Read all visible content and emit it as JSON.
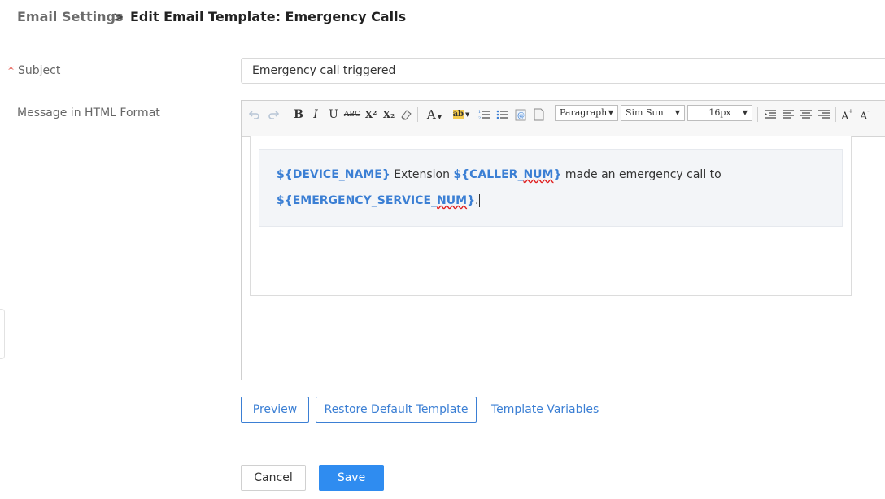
{
  "breadcrumb": {
    "root": "Email Settings",
    "separator": ">",
    "current": "Edit Email Template: Emergency Calls"
  },
  "form": {
    "subject_label": "Subject",
    "subject_required_mark": "*",
    "subject_value": "Emergency call triggered",
    "message_label": "Message in HTML Format"
  },
  "toolbar": {
    "undo_icon": "undo-icon",
    "redo_icon": "redo-icon",
    "bold": "B",
    "italic": "I",
    "underline": "U",
    "strikethrough": "ABC",
    "superscript": "X²",
    "subscript": "X₂",
    "eraser_icon": "eraser-icon",
    "font_color": "A",
    "highlight": "ab",
    "paragraph_select": "Paragraph",
    "font_select": "Sim Sun",
    "size_select": "16px",
    "dropdown_arrow": "▼"
  },
  "editor_content": {
    "device_var": "${DEVICE_NAME}",
    "text_extension": " Extension ",
    "caller_var_prefix": "${CALLER_",
    "caller_var_squig": "NUM",
    "caller_var_suffix": "}",
    "text_made_call": " made an emergency call to",
    "service_var_prefix": "${EMERGENCY_SERVICE_",
    "service_var_squig": "NUM",
    "service_var_suffix": "}",
    "period": "."
  },
  "actions": {
    "preview": "Preview",
    "restore": "Restore Default Template",
    "template_variables": "Template Variables",
    "cancel": "Cancel",
    "save": "Save"
  },
  "colors": {
    "accent": "#3b7fd4",
    "primary_button": "#2f8cf0",
    "required": "#e0453a",
    "spellcheck": "#e02020"
  }
}
